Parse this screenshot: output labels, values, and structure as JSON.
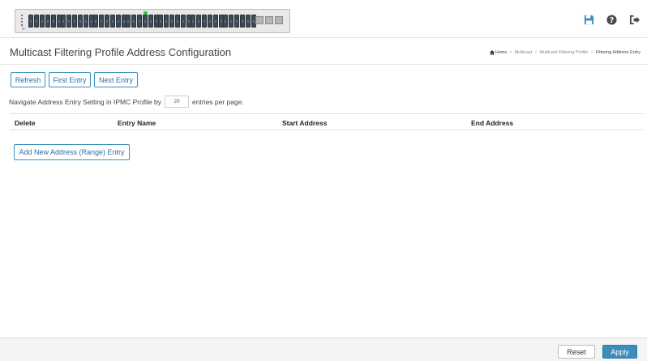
{
  "header": {
    "switch_panel_label": "switch-port-panel",
    "icons": [
      "save-icon",
      "help-icon",
      "logout-icon"
    ],
    "accent_color": "#3c8dbc"
  },
  "titlebar": {
    "title": "Multicast Filtering Profile Address Configuration",
    "breadcrumb": {
      "home": "Home",
      "items": [
        "Multicast",
        "Multicast Filtering Profile"
      ],
      "current": "Filtering Address Entry"
    }
  },
  "nav_buttons": {
    "refresh": "Refresh",
    "first_entry": "First Entry",
    "next_entry": "Next Entry"
  },
  "navigate": {
    "prefix": "Navigate Address Entry Setting in IPMC Profile by",
    "entries_value": "20",
    "suffix": "entries per page."
  },
  "table": {
    "columns": [
      "Delete",
      "Entry Name",
      "Start Address",
      "End Address"
    ]
  },
  "add_button": "Add New Address (Range) Entry",
  "footer": {
    "reset": "Reset",
    "apply": "Apply"
  }
}
